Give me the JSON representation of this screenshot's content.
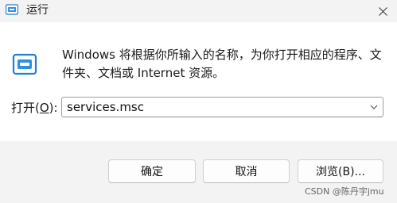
{
  "window": {
    "title": "运行",
    "close_glyph": "✕"
  },
  "dialog": {
    "description": "Windows 将根据你所输入的名称，为你打开相应的程序、文件夹、文档或 Internet 资源。",
    "open_label_prefix": "打开(",
    "open_label_accesskey": "O",
    "open_label_suffix": "):",
    "command_value": "services.msc"
  },
  "buttons": {
    "ok_label": "确定",
    "cancel_label": "取消",
    "browse_label": "浏览(B)..."
  },
  "watermark": "CSDN @陈丹宇jmu",
  "icons": {
    "title": "run-icon",
    "dialog": "run-app-icon",
    "close": "close-icon",
    "dropdown": "chevron-down-icon"
  },
  "colors": {
    "accent": "#1e7fd6",
    "content_bg": "#ffffff",
    "footer_bg": "#f3f3f3"
  }
}
